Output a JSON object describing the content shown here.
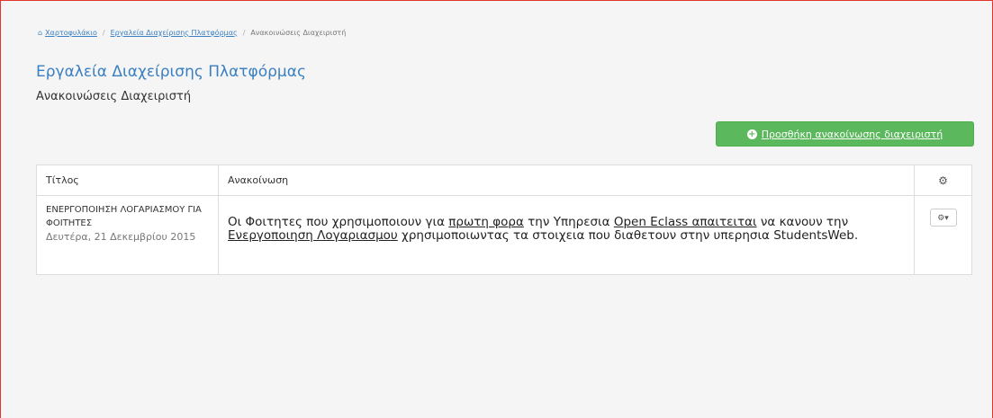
{
  "breadcrumb": {
    "home": "Χαρτοφυλάκιο",
    "tools": "Εργαλεία Διαχείρισης Πλατφόρμας",
    "current": "Ανακοινώσεις Διαχειριστή"
  },
  "page": {
    "title": "Εργαλεία Διαχείρισης Πλατφόρμας",
    "subtitle": "Ανακοινώσεις Διαχειριστή"
  },
  "add_button": {
    "label": "Προσθήκη ανακοίνωσης διαχειριστή",
    "color": "#5cb85c"
  },
  "table": {
    "headers": {
      "title": "Τίτλος",
      "content": "Ανακοίνωση",
      "actions_icon": "gears-icon"
    },
    "rows": [
      {
        "title": "ΕΝΕΡΓΟΠΟΙΗΣΗ ΛΟΓΑΡΙΑΣΜΟΥ ΓΙΑ ΦΟΙΤΗΤΕΣ",
        "date": "Δευτέρα, 21 Δεκεμβρίου 2015",
        "content": {
          "p1": "Οι Φοιτητες που χρησιμοποιουν για ",
          "u1": "πρωτη φορα",
          "p2": " την Υπηρεσια ",
          "u2": "Open Eclass απαιτειται",
          "p3": " να κανουν την ",
          "u3": "Ενεργοποιηση Λογαριασμου",
          "p4": " χρησιμοποιωντας  τα στοιχεια που διαθετουν στην υπερησια StudentsWeb."
        },
        "action_icon": "gear-dropdown-icon"
      }
    ]
  },
  "colors": {
    "link": "#3a7fc1",
    "frame": "#e3342f"
  }
}
